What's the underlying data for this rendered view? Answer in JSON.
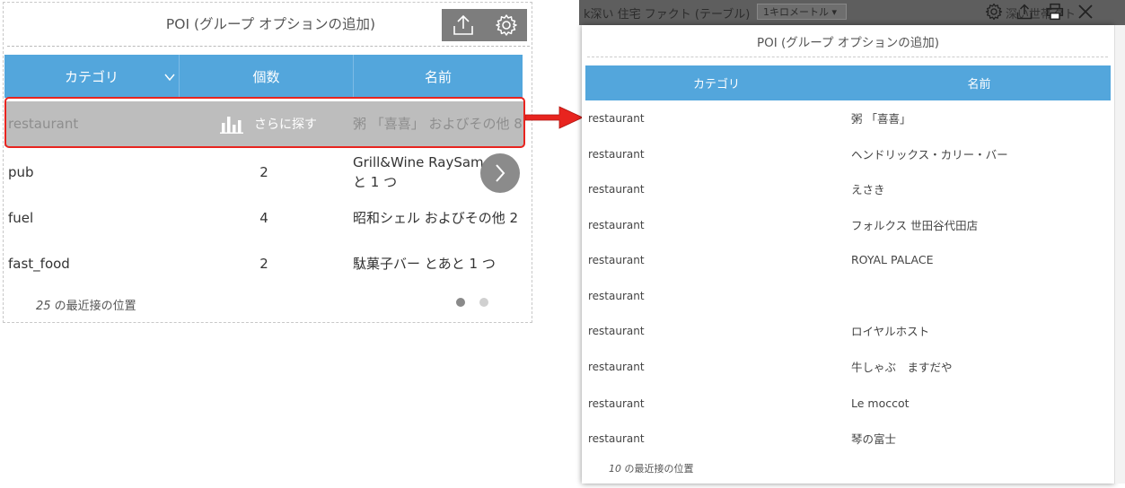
{
  "left": {
    "title": "POI (グループ オプションの追加)",
    "headers": {
      "category": "カテゴリ",
      "count": "個数",
      "name": "名前"
    },
    "rows": [
      {
        "category": "restaurant",
        "count": "",
        "name": "粥 「喜喜」 およびその他 8"
      },
      {
        "category": "pub",
        "count": "2",
        "name": "Grill&Wine RaySam とあと 1 つ"
      },
      {
        "category": "fuel",
        "count": "4",
        "name": "昭和シェル およびその他 2"
      },
      {
        "category": "fast_food",
        "count": "2",
        "name": "駄菓子バー とあと 1 つ"
      }
    ],
    "explore_label": "さらに探す",
    "footer_count": "25",
    "footer_text": " の最近接の位置",
    "page_dots": 2,
    "active_page": 1
  },
  "background": {
    "title_text": "k深い 住宅 ファクト (テーブル)",
    "distance_chip": "1キロメートル ▾",
    "right_text": "深い世帯クト"
  },
  "right": {
    "title": "POI (グループ オプションの追加)",
    "headers": {
      "category": "カテゴリ",
      "name": "名前"
    },
    "rows": [
      {
        "category": "restaurant",
        "name": "粥 「喜喜」"
      },
      {
        "category": "restaurant",
        "name": "ヘンドリックス・カリー・バー"
      },
      {
        "category": "restaurant",
        "name": "えさき"
      },
      {
        "category": "restaurant",
        "name": "フォルクス 世田谷代田店"
      },
      {
        "category": "restaurant",
        "name": "ROYAL PALACE"
      },
      {
        "category": "restaurant",
        "name": ""
      },
      {
        "category": "restaurant",
        "name": "ロイヤルホスト"
      },
      {
        "category": "restaurant",
        "name": "牛しゃぶ　ますだや"
      },
      {
        "category": "restaurant",
        "name": "Le moccot"
      },
      {
        "category": "restaurant",
        "name": "琴の富士"
      }
    ],
    "footer_count": "10",
    "footer_text": " の最近接の位置"
  },
  "icons": {
    "left_toolbar": [
      "export-icon",
      "settings-gear-icon"
    ],
    "right_toolbar": [
      "settings-gear-icon",
      "export-icon",
      "print-icon",
      "close-icon"
    ]
  },
  "colors": {
    "header_blue": "#53a6dc",
    "highlight_red": "#e8241f",
    "toolbar_gray": "#7d7d7d",
    "selected_row_gray": "#bdbdbd"
  }
}
